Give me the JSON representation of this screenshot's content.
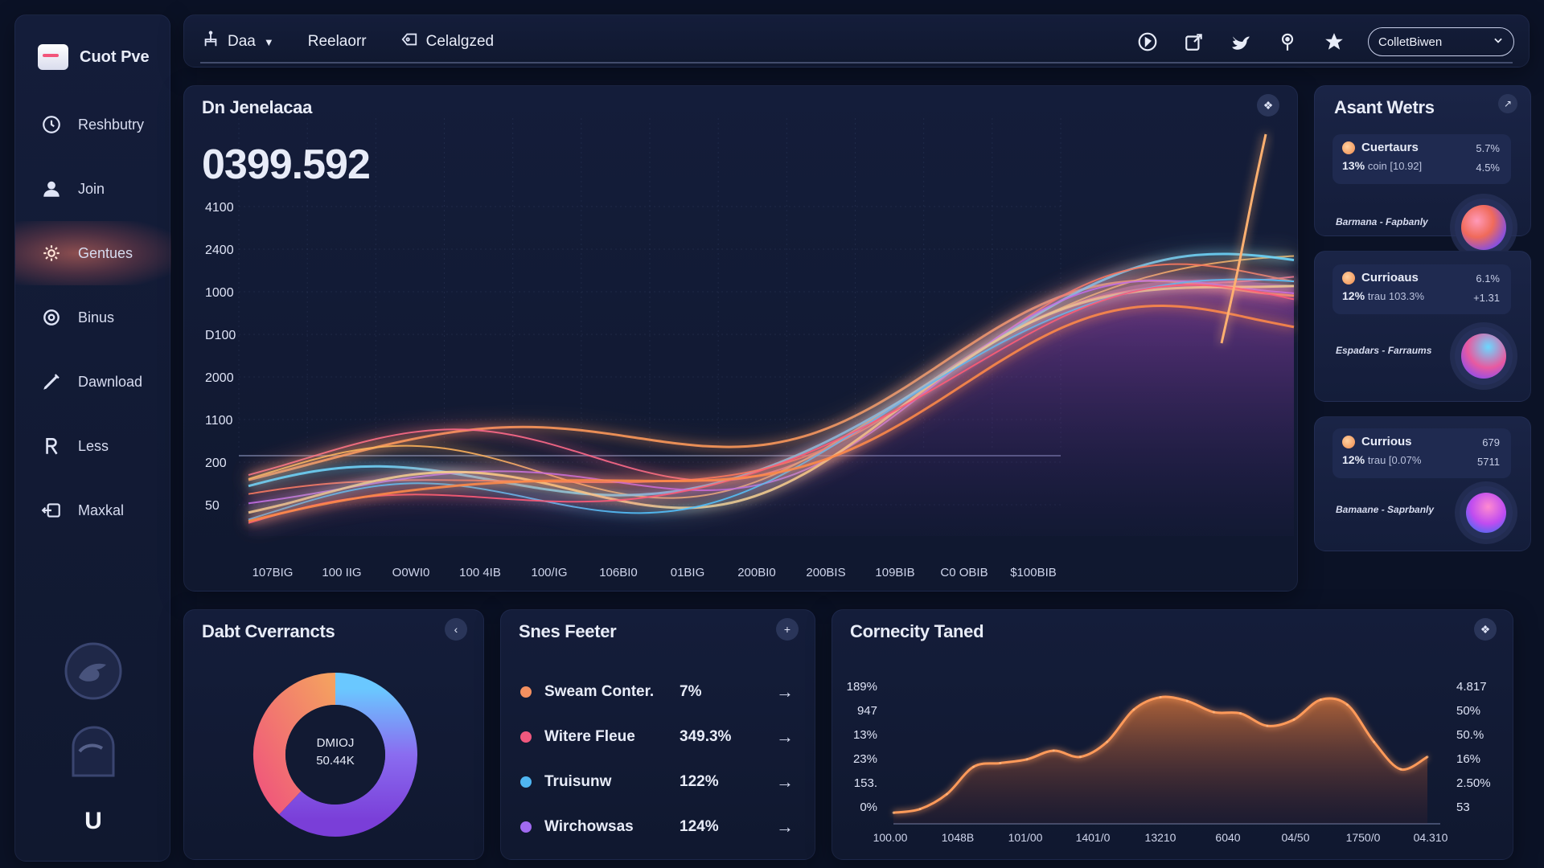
{
  "app": {
    "name": "Cuot Pve"
  },
  "sidebar": {
    "items": [
      {
        "label": "Reshbutry",
        "icon": "clock-icon"
      },
      {
        "label": "Join",
        "icon": "user-icon"
      },
      {
        "label": "Gentues",
        "icon": "settings-icon",
        "active": true
      },
      {
        "label": "Binus",
        "icon": "gear-icon"
      },
      {
        "label": "Dawnload",
        "icon": "pen-icon"
      },
      {
        "label": "Less",
        "icon": "r-icon"
      },
      {
        "label": "Maxkal",
        "icon": "logout-icon"
      }
    ],
    "bottom_letter": "U"
  },
  "topbar": {
    "nav": [
      {
        "label": "Daa",
        "icon": "hierarchy-icon",
        "dropdown": true
      },
      {
        "label": "Reelaorr"
      },
      {
        "label": "Celalgzed",
        "icon": "tag-icon"
      }
    ],
    "icons": [
      "clock-icon",
      "share-icon",
      "bird-icon",
      "pin-icon",
      "star-icon"
    ],
    "select_value": "ColletBiwen"
  },
  "main_chart": {
    "title": "Dn Jenelacaa",
    "big_value": "0399.592",
    "y_ticks": [
      "4100",
      "2400",
      "1000",
      "D100",
      "2000",
      "1100",
      "200",
      "50"
    ],
    "x_ticks": [
      "107BIG",
      "100 IIG",
      "O0WI0",
      "100 4IB",
      "100/IG",
      "106BI0",
      "01BIG",
      "200BI0",
      "200BIS",
      "109BIB",
      "C0 OBIB",
      "$100BIB"
    ]
  },
  "assets": {
    "title": "Asant Wetrs",
    "cards": [
      {
        "name": "Cuertaurs",
        "top_val": "5.7%",
        "sub_pct": "13%",
        "sub_text": "coin [10.92]",
        "sub_val": "4.5%",
        "footer": "Barmana - Fapbanly"
      },
      {
        "name": "Currioaus",
        "top_val": "6.1%",
        "sub_pct": "12%",
        "sub_text": "trau 103.3%",
        "sub_val": "+1.31",
        "footer": "Espadars - Farraums"
      },
      {
        "name": "Currious",
        "top_val": "679",
        "sub_pct": "12%",
        "sub_text": "trau [0.07%",
        "sub_val": "5711",
        "footer": "Bamaane - Saprbanly"
      }
    ]
  },
  "donut": {
    "title": "Dabt Cverrancts",
    "center_line1": "DMIOJ",
    "center_line2": "50.44K",
    "segments": [
      {
        "value": 38,
        "color": "#f4a06a"
      },
      {
        "value": 62,
        "color": "#8a6cf0"
      }
    ]
  },
  "list_panel": {
    "title": "Snes Feeter",
    "rows": [
      {
        "name": "Sweam Conter.",
        "value": "7%",
        "color": "#f49060"
      },
      {
        "name": "Witere Fleue",
        "value": "349.3%",
        "color": "#f0587e"
      },
      {
        "name": "Truisunw",
        "value": "122%",
        "color": "#4fb6f2"
      },
      {
        "name": "Wirchowsas",
        "value": "124%",
        "color": "#a06af0"
      }
    ]
  },
  "area_panel": {
    "title": "Cornecity Taned",
    "left_ticks": [
      "189%",
      "947",
      "13%",
      "23%",
      "153.",
      "0%"
    ],
    "right_ticks": [
      "4.817",
      "50%",
      "50.%",
      "16%",
      "2.50%",
      "53"
    ],
    "x_ticks": [
      "100.00",
      "1048B",
      "101/00",
      "1401/0",
      "13210",
      "6040",
      "04/50",
      "1750/0",
      "04.310"
    ]
  },
  "chart_data": {
    "type": "area",
    "x": [
      0,
      1,
      2,
      3,
      4,
      5,
      6,
      7,
      8,
      9,
      10,
      11,
      12,
      13,
      14,
      15,
      16,
      17,
      18,
      19,
      20
    ],
    "series": [
      {
        "values": [
          5,
          8,
          20,
          42,
          45,
          48,
          55,
          50,
          62,
          88,
          98,
          95,
          86,
          85,
          75,
          80,
          96,
          92,
          62,
          40,
          50
        ]
      }
    ],
    "ylim": [
      0,
      110
    ]
  }
}
